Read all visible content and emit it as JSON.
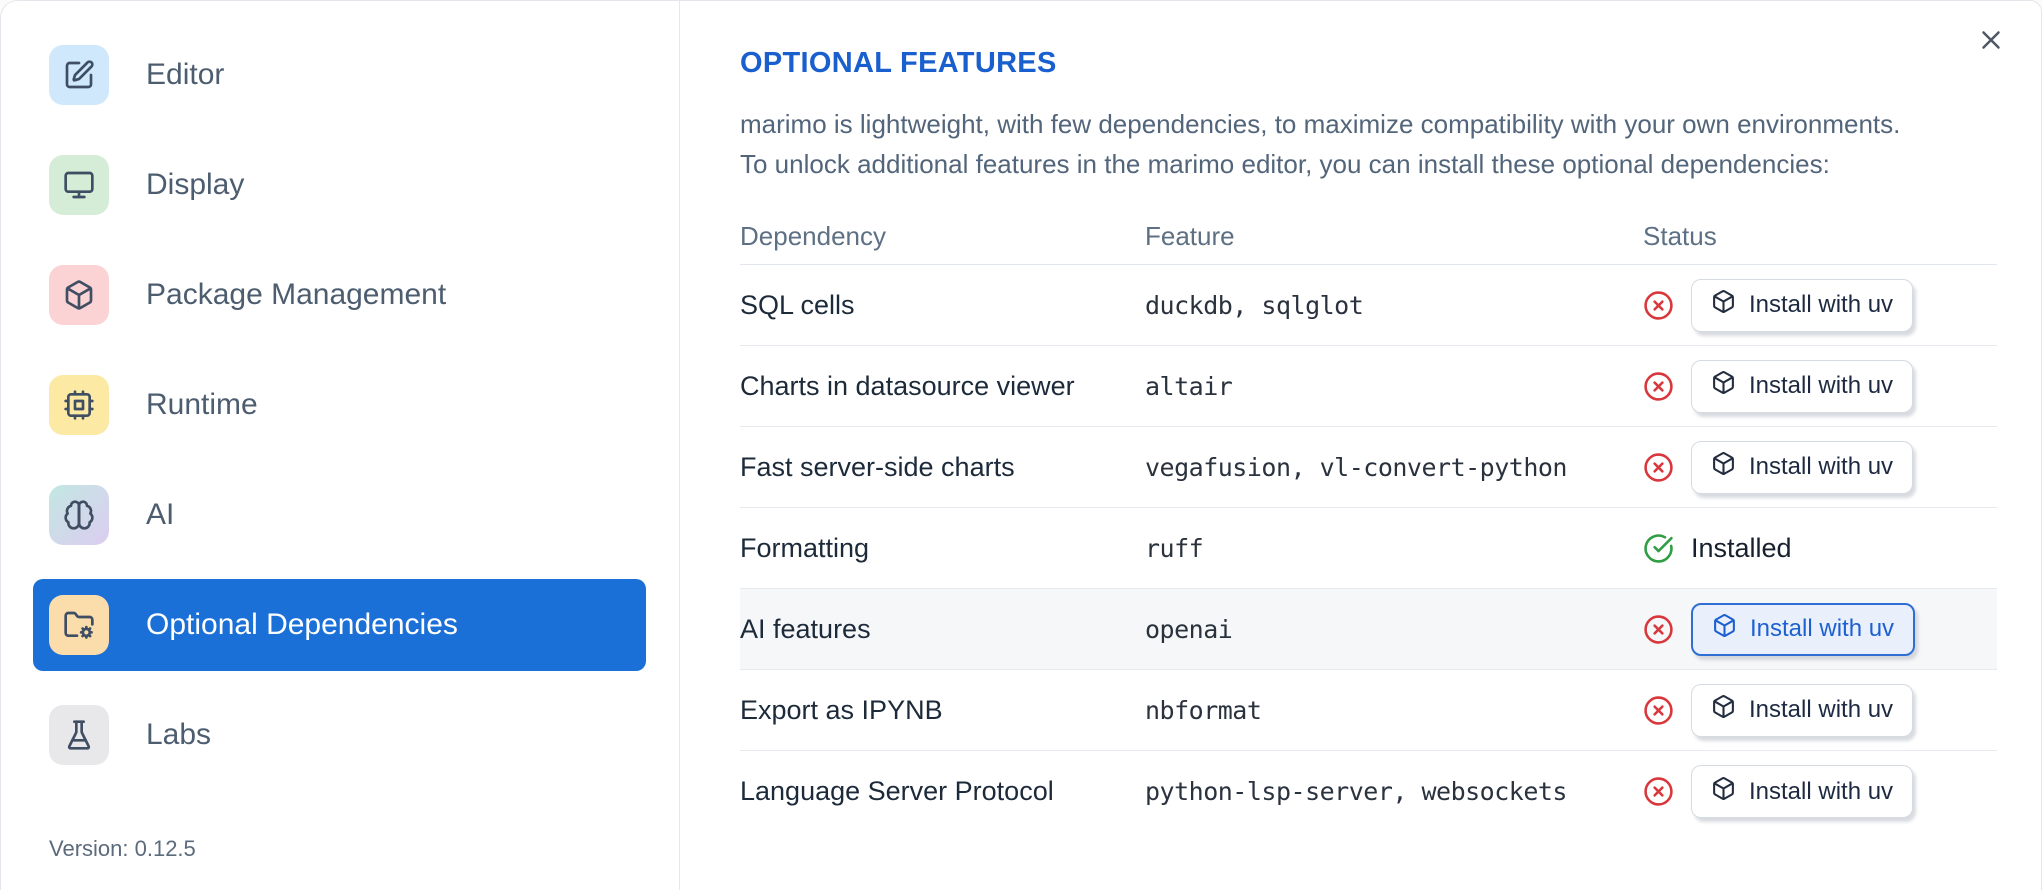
{
  "sidebar": {
    "items": [
      {
        "label": "Editor",
        "icon": "square-pen-icon",
        "tile_color": "#cfe8fb",
        "selected": false
      },
      {
        "label": "Display",
        "icon": "monitor-icon",
        "tile_color": "#d5ecd6",
        "selected": false
      },
      {
        "label": "Package Management",
        "icon": "package-icon",
        "tile_color": "#fbd3d4",
        "selected": false
      },
      {
        "label": "Runtime",
        "icon": "cpu-icon",
        "tile_color": "#fbe9a4",
        "selected": false
      },
      {
        "label": "AI",
        "icon": "brain-icon",
        "tile_color": "#c2e7e2",
        "tile_color2": "#dccdf0",
        "selected": false
      },
      {
        "label": "Optional Dependencies",
        "icon": "folder-cog-icon",
        "tile_color": "#fbdcab",
        "selected": true
      },
      {
        "label": "Labs",
        "icon": "flask-icon",
        "tile_color": "#e8e8eb",
        "selected": false
      }
    ],
    "version_label": "Version: 0.12.5",
    "selected_color": "#1b70d8"
  },
  "panel": {
    "title": "OPTIONAL FEATURES",
    "title_color": "#1a5fce",
    "close_icon": "close-icon",
    "description_lines": [
      "marimo is lightweight, with few dependencies, to maximize compatibility with your own environments.",
      "To unlock additional features in the marimo editor, you can install these optional dependencies:"
    ]
  },
  "table": {
    "columns": [
      "Dependency",
      "Feature",
      "Status"
    ],
    "status_colors": {
      "not_installed": "#d8373c",
      "installed": "#2f9e44"
    },
    "rows": [
      {
        "dependency": "SQL cells",
        "feature": "duckdb, sqlglot",
        "status": "not_installed",
        "status_icon": "circle-x-icon",
        "action_label": "Install with uv",
        "action_icon": "box-icon",
        "action_focused": false,
        "row_hovered": false
      },
      {
        "dependency": "Charts in datasource viewer",
        "feature": "altair",
        "status": "not_installed",
        "status_icon": "circle-x-icon",
        "action_label": "Install with uv",
        "action_icon": "box-icon",
        "action_focused": false,
        "row_hovered": false
      },
      {
        "dependency": "Fast server-side charts",
        "feature": "vegafusion, vl-convert-python",
        "status": "not_installed",
        "status_icon": "circle-x-icon",
        "action_label": "Install with uv",
        "action_icon": "box-icon",
        "action_focused": false,
        "row_hovered": false
      },
      {
        "dependency": "Formatting",
        "feature": "ruff",
        "status": "installed",
        "status_icon": "circle-check-icon",
        "status_label": "Installed"
      },
      {
        "dependency": "AI features",
        "feature": "openai",
        "status": "not_installed",
        "status_icon": "circle-x-icon",
        "action_label": "Install with uv",
        "action_icon": "box-icon",
        "action_focused": true,
        "row_hovered": true
      },
      {
        "dependency": "Export as IPYNB",
        "feature": "nbformat",
        "status": "not_installed",
        "status_icon": "circle-x-icon",
        "action_label": "Install with uv",
        "action_icon": "box-icon",
        "action_focused": false,
        "row_hovered": false
      },
      {
        "dependency": "Language Server Protocol",
        "feature": "python-lsp-server, websockets",
        "status": "not_installed",
        "status_icon": "circle-x-icon",
        "action_label": "Install with uv",
        "action_icon": "box-icon",
        "action_focused": false,
        "row_hovered": false
      }
    ]
  }
}
